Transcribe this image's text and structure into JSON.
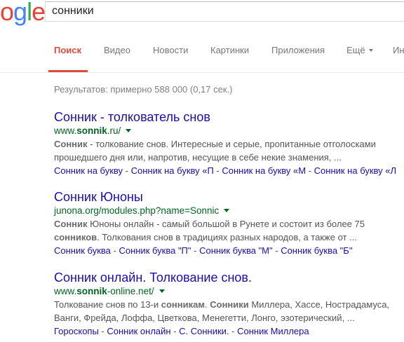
{
  "logo": {
    "letters": [
      "o",
      "g",
      "l",
      "e"
    ],
    "colors": [
      "#ea4335",
      "#fbbc05",
      "#4285f4",
      "#34a853",
      "#ea4335"
    ]
  },
  "search": {
    "query": "сонники"
  },
  "tabs": {
    "search": "Поиск",
    "video": "Видео",
    "news": "Новости",
    "images": "Картинки",
    "apps": "Приложения",
    "more": "Ещё",
    "tools_partial": "Ин"
  },
  "stats": "Результатов: примерно 588 000 (0,17 сек.)",
  "results": [
    {
      "title": "Сонник - толкователь снов",
      "url_pre": "www.",
      "url_bold": "sonnik",
      "url_post": ".ru/",
      "snippet_line1_bold": "Сонник",
      "snippet_line1_rest": " - толкование снов. Интересные и серые, пропитанные отголосками",
      "snippet_line2": "прошедшего дня или, напротив, несущие в себе некие знамения, ...",
      "links": [
        "Сонник на букву",
        "Сонник на букву «П",
        "Сонник на букву «М",
        "Сонник на букву «Л"
      ]
    },
    {
      "title": "Сонник Юноны",
      "url_pre": "junona.org/modules.php?name=Sonnic",
      "snippet_line1_bold": "Сонник",
      "snippet_line1_rest": " Юноны онлайн - самый большой в Рунете и состоит из более 75",
      "snippet_line2_bold": "сонников",
      "snippet_line2_rest": ". Толкования снов в традициях разных народов, а также от ...",
      "links": [
        "Сонник буква",
        "Сонник буква \"П\"",
        "Сонник буква \"М\"",
        "Сонник буква \"Б\""
      ]
    },
    {
      "title": "Сонник онлайн. Толкование снов.",
      "url_pre": "www.",
      "url_bold": "sonnik",
      "url_post": "-online.net/",
      "snippet_line1_pre": "Толкование снов по 13-и ",
      "snippet_line1_bold1": "сонникам",
      "snippet_line1_mid": ". ",
      "snippet_line1_bold2": "Сонники",
      "snippet_line1_rest": " Миллера, Хассе, Нострадамуса,",
      "snippet_line2": "Ванги, Фрейда, Лоффа, Цветкова, Менегетти, Лонго, эзотерический, ...",
      "links": [
        "Гороскопы",
        "Сонник онлайн",
        "С. Сонники.",
        "Сонник Миллера"
      ]
    }
  ]
}
